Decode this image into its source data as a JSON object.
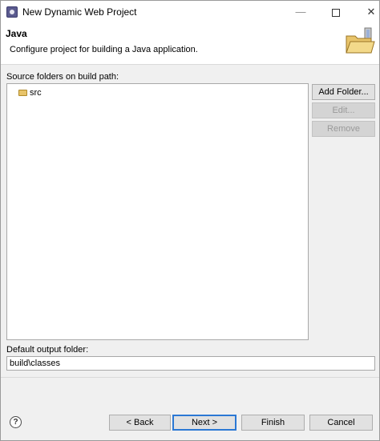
{
  "window": {
    "title": "New Dynamic Web Project",
    "minimize_glyph": "—",
    "close_glyph": "✕"
  },
  "header": {
    "title": "Java",
    "description": "Configure project for building a Java application."
  },
  "source": {
    "label": "Source folders on build path:",
    "items": [
      {
        "label": "src"
      }
    ],
    "buttons": {
      "add": "Add Folder...",
      "edit": "Edit...",
      "remove": "Remove"
    }
  },
  "output": {
    "label": "Default output folder:",
    "value": "build\\classes"
  },
  "footer": {
    "help_glyph": "?",
    "back": "< Back",
    "next": "Next >",
    "finish": "Finish",
    "cancel": "Cancel"
  }
}
